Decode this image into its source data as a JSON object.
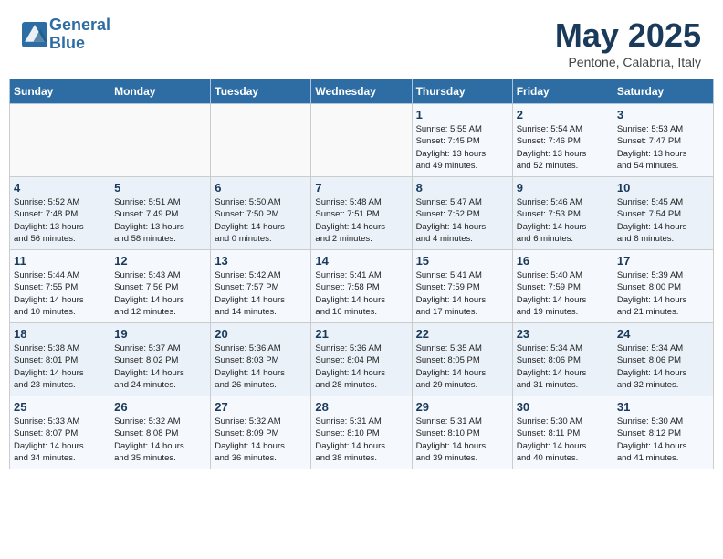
{
  "header": {
    "logo_line1": "General",
    "logo_line2": "Blue",
    "month": "May 2025",
    "location": "Pentone, Calabria, Italy"
  },
  "weekdays": [
    "Sunday",
    "Monday",
    "Tuesday",
    "Wednesday",
    "Thursday",
    "Friday",
    "Saturday"
  ],
  "weeks": [
    [
      {
        "day": "",
        "info": ""
      },
      {
        "day": "",
        "info": ""
      },
      {
        "day": "",
        "info": ""
      },
      {
        "day": "",
        "info": ""
      },
      {
        "day": "1",
        "info": "Sunrise: 5:55 AM\nSunset: 7:45 PM\nDaylight: 13 hours\nand 49 minutes."
      },
      {
        "day": "2",
        "info": "Sunrise: 5:54 AM\nSunset: 7:46 PM\nDaylight: 13 hours\nand 52 minutes."
      },
      {
        "day": "3",
        "info": "Sunrise: 5:53 AM\nSunset: 7:47 PM\nDaylight: 13 hours\nand 54 minutes."
      }
    ],
    [
      {
        "day": "4",
        "info": "Sunrise: 5:52 AM\nSunset: 7:48 PM\nDaylight: 13 hours\nand 56 minutes."
      },
      {
        "day": "5",
        "info": "Sunrise: 5:51 AM\nSunset: 7:49 PM\nDaylight: 13 hours\nand 58 minutes."
      },
      {
        "day": "6",
        "info": "Sunrise: 5:50 AM\nSunset: 7:50 PM\nDaylight: 14 hours\nand 0 minutes."
      },
      {
        "day": "7",
        "info": "Sunrise: 5:48 AM\nSunset: 7:51 PM\nDaylight: 14 hours\nand 2 minutes."
      },
      {
        "day": "8",
        "info": "Sunrise: 5:47 AM\nSunset: 7:52 PM\nDaylight: 14 hours\nand 4 minutes."
      },
      {
        "day": "9",
        "info": "Sunrise: 5:46 AM\nSunset: 7:53 PM\nDaylight: 14 hours\nand 6 minutes."
      },
      {
        "day": "10",
        "info": "Sunrise: 5:45 AM\nSunset: 7:54 PM\nDaylight: 14 hours\nand 8 minutes."
      }
    ],
    [
      {
        "day": "11",
        "info": "Sunrise: 5:44 AM\nSunset: 7:55 PM\nDaylight: 14 hours\nand 10 minutes."
      },
      {
        "day": "12",
        "info": "Sunrise: 5:43 AM\nSunset: 7:56 PM\nDaylight: 14 hours\nand 12 minutes."
      },
      {
        "day": "13",
        "info": "Sunrise: 5:42 AM\nSunset: 7:57 PM\nDaylight: 14 hours\nand 14 minutes."
      },
      {
        "day": "14",
        "info": "Sunrise: 5:41 AM\nSunset: 7:58 PM\nDaylight: 14 hours\nand 16 minutes."
      },
      {
        "day": "15",
        "info": "Sunrise: 5:41 AM\nSunset: 7:59 PM\nDaylight: 14 hours\nand 17 minutes."
      },
      {
        "day": "16",
        "info": "Sunrise: 5:40 AM\nSunset: 7:59 PM\nDaylight: 14 hours\nand 19 minutes."
      },
      {
        "day": "17",
        "info": "Sunrise: 5:39 AM\nSunset: 8:00 PM\nDaylight: 14 hours\nand 21 minutes."
      }
    ],
    [
      {
        "day": "18",
        "info": "Sunrise: 5:38 AM\nSunset: 8:01 PM\nDaylight: 14 hours\nand 23 minutes."
      },
      {
        "day": "19",
        "info": "Sunrise: 5:37 AM\nSunset: 8:02 PM\nDaylight: 14 hours\nand 24 minutes."
      },
      {
        "day": "20",
        "info": "Sunrise: 5:36 AM\nSunset: 8:03 PM\nDaylight: 14 hours\nand 26 minutes."
      },
      {
        "day": "21",
        "info": "Sunrise: 5:36 AM\nSunset: 8:04 PM\nDaylight: 14 hours\nand 28 minutes."
      },
      {
        "day": "22",
        "info": "Sunrise: 5:35 AM\nSunset: 8:05 PM\nDaylight: 14 hours\nand 29 minutes."
      },
      {
        "day": "23",
        "info": "Sunrise: 5:34 AM\nSunset: 8:06 PM\nDaylight: 14 hours\nand 31 minutes."
      },
      {
        "day": "24",
        "info": "Sunrise: 5:34 AM\nSunset: 8:06 PM\nDaylight: 14 hours\nand 32 minutes."
      }
    ],
    [
      {
        "day": "25",
        "info": "Sunrise: 5:33 AM\nSunset: 8:07 PM\nDaylight: 14 hours\nand 34 minutes."
      },
      {
        "day": "26",
        "info": "Sunrise: 5:32 AM\nSunset: 8:08 PM\nDaylight: 14 hours\nand 35 minutes."
      },
      {
        "day": "27",
        "info": "Sunrise: 5:32 AM\nSunset: 8:09 PM\nDaylight: 14 hours\nand 36 minutes."
      },
      {
        "day": "28",
        "info": "Sunrise: 5:31 AM\nSunset: 8:10 PM\nDaylight: 14 hours\nand 38 minutes."
      },
      {
        "day": "29",
        "info": "Sunrise: 5:31 AM\nSunset: 8:10 PM\nDaylight: 14 hours\nand 39 minutes."
      },
      {
        "day": "30",
        "info": "Sunrise: 5:30 AM\nSunset: 8:11 PM\nDaylight: 14 hours\nand 40 minutes."
      },
      {
        "day": "31",
        "info": "Sunrise: 5:30 AM\nSunset: 8:12 PM\nDaylight: 14 hours\nand 41 minutes."
      }
    ]
  ]
}
